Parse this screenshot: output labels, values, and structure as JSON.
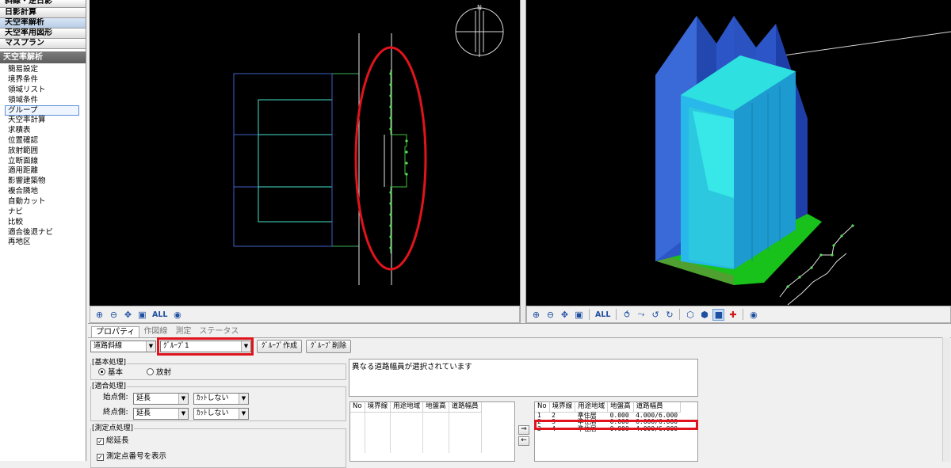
{
  "sidebar": {
    "top_buttons": [
      "斜線・逆日影",
      "日影計算",
      "天空率解析",
      "天空率用図形",
      "マスプラン"
    ],
    "active_top": "天空率解析",
    "section_header": "天空率解析",
    "items": [
      "簡易設定",
      "境界条件",
      "領域リスト",
      "領域条件",
      "グループ",
      "天空率計算",
      "求積表",
      "位置確認",
      "放射範囲",
      "立断面線",
      "適用距離",
      "影響建築物",
      "複合隣地",
      "自動カット",
      "ナビ",
      "比較",
      "適合後退ナビ",
      "再地区"
    ],
    "selected_item": "グループ"
  },
  "toolbar_left": {
    "all_label": "ALL"
  },
  "toolbar_right": {
    "all_label": "ALL"
  },
  "panel": {
    "tabs": [
      "プロパティ",
      "作図線",
      "測定",
      "ステータス"
    ],
    "active_tab": "プロパティ",
    "type_select": "道路斜線",
    "group_select": "ｸﾞﾙｰﾌﾟ1",
    "create_group_button": "ｸﾞﾙｰﾌﾟ作成",
    "delete_group_button": "ｸﾞﾙｰﾌﾟ削除",
    "basic_group": {
      "title": "[基本処理]",
      "options": [
        "基本",
        "放射"
      ],
      "selected": "基本"
    },
    "adapt_group": {
      "title": "[適合処理]",
      "start_label": "始点側:",
      "end_label": "終点側:",
      "start_mode": "延長",
      "start_cut": "ｶｯﾄしない",
      "end_mode": "延長",
      "end_cut": "ｶｯﾄしない"
    },
    "measure_group": {
      "title": "[測定点処理]",
      "checks": [
        "総延長",
        "測定点番号を表示"
      ]
    },
    "message": "異なる道路幅員が選択されています",
    "left_table": {
      "columns": [
        "No",
        "境界線",
        "用途地域",
        "地盤高",
        "道路幅員"
      ],
      "rows": []
    },
    "right_table": {
      "columns": [
        "No",
        "境界線",
        "用途地域",
        "地盤高",
        "道路幅員"
      ],
      "rows": [
        [
          "1",
          "2",
          "準住居",
          "0.000",
          "4.000/6.000"
        ],
        [
          "2",
          "3",
          "準住居",
          "0.000",
          "6.000/6.000"
        ],
        [
          "3",
          "4",
          "準住居",
          "0.000",
          "4.000/6.000"
        ]
      ]
    },
    "move_right": "⇒",
    "move_left": "←"
  },
  "colors": {
    "highlight_red": "#e0141c",
    "building_cyan": "#2fd6d6",
    "building_blue": "#2c56c8",
    "ground_green": "#18c21a",
    "plan_line_blue": "#3f5fc6",
    "plan_line_cyan": "#46e0c8"
  }
}
